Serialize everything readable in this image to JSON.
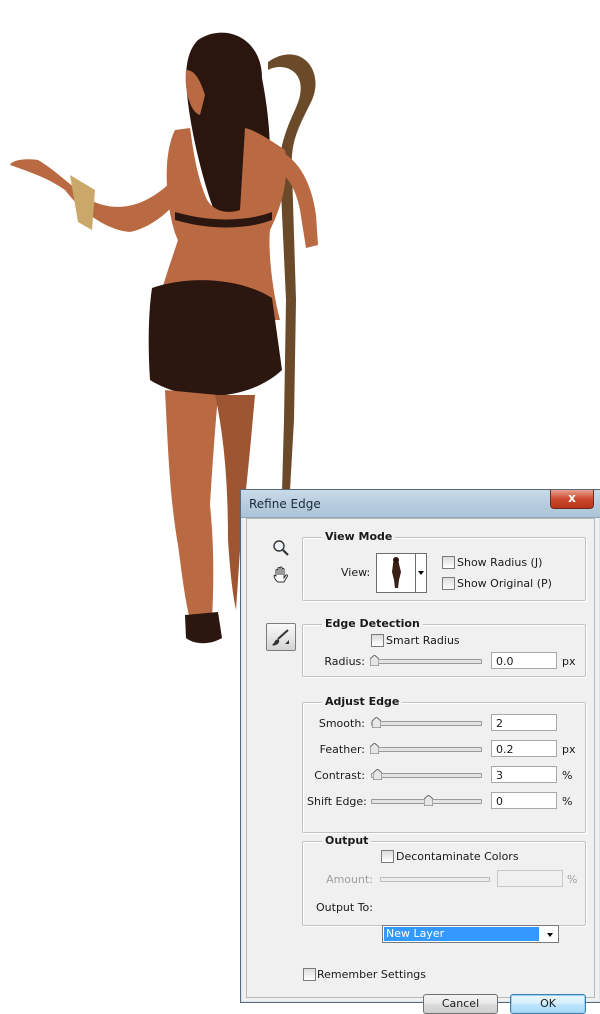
{
  "dialog": {
    "title": "Refine Edge",
    "close_label": "x"
  },
  "tools": [
    "zoom-tool",
    "hand-tool",
    "refine-radius-brush"
  ],
  "view_mode": {
    "title": "View Mode",
    "view_label": "View:",
    "show_radius_label": "Show Radius (J)",
    "show_radius_checked": false,
    "show_original_label": "Show Original (P)",
    "show_original_checked": false
  },
  "edge_detection": {
    "title": "Edge Detection",
    "smart_radius_label": "Smart Radius",
    "smart_radius_checked": false,
    "radius_label": "Radius:",
    "radius_value": "0.0",
    "radius_unit": "px",
    "radius_level": 0.0
  },
  "adjust_edge": {
    "title": "Adjust Edge",
    "smooth_label": "Smooth:",
    "smooth_value": "2",
    "smooth_level": 0.02,
    "feather_label": "Feather:",
    "feather_value": "0.2",
    "feather_unit": "px",
    "feather_level": 0.0,
    "contrast_label": "Contrast:",
    "contrast_value": "3",
    "contrast_unit": "%",
    "contrast_level": 0.03,
    "shift_edge_label": "Shift Edge:",
    "shift_edge_value": "0",
    "shift_edge_unit": "%",
    "shift_edge_level": 0.5
  },
  "output": {
    "title": "Output",
    "decontaminate_label": "Decontaminate Colors",
    "decontaminate_checked": false,
    "amount_label": "Amount:",
    "amount_value": "",
    "amount_unit": "%",
    "output_to_label": "Output To:",
    "output_to_value": "New Layer"
  },
  "remember_settings_label": "Remember Settings",
  "remember_settings_checked": false,
  "buttons": {
    "cancel": "Cancel",
    "ok": "OK"
  },
  "colors": {
    "skin": "#b96a42",
    "hair": "#2a160e",
    "garment": "#2b1610",
    "staff": "#6b4a2a",
    "selection": "#3399ff"
  }
}
